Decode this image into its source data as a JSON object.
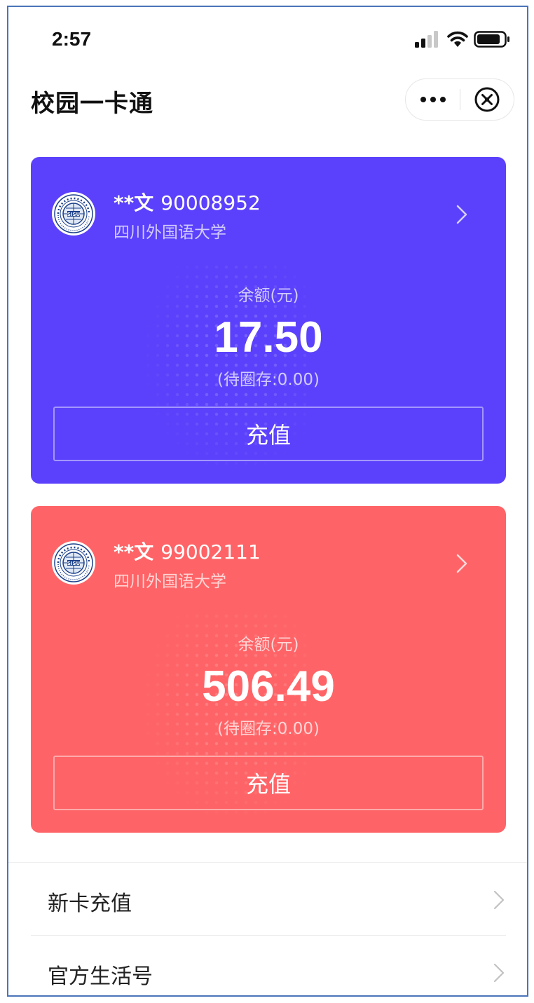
{
  "status_bar": {
    "time": "2:57",
    "icons": [
      "signal-icon",
      "wifi-icon",
      "battery-icon"
    ]
  },
  "header": {
    "title": "校园一卡通",
    "more_icon": "more-icon",
    "close_icon": "close-icon"
  },
  "cards": [
    {
      "owner": "**文",
      "card_number": "90008952",
      "school": "四川外国语大学",
      "balance_label": "余额(元)",
      "balance": "17.50",
      "pending": "(待圈存:0.00)",
      "recharge_label": "充值",
      "color": "#5b41fb"
    },
    {
      "owner": "**文",
      "card_number": "99002111",
      "school": "四川外国语大学",
      "balance_label": "余额(元)",
      "balance": "506.49",
      "pending": "(待圈存:0.00)",
      "recharge_label": "充值",
      "color": "#fe6467"
    }
  ],
  "menu": {
    "items": [
      {
        "label": "新卡充值"
      },
      {
        "label": "官方生活号"
      }
    ]
  }
}
